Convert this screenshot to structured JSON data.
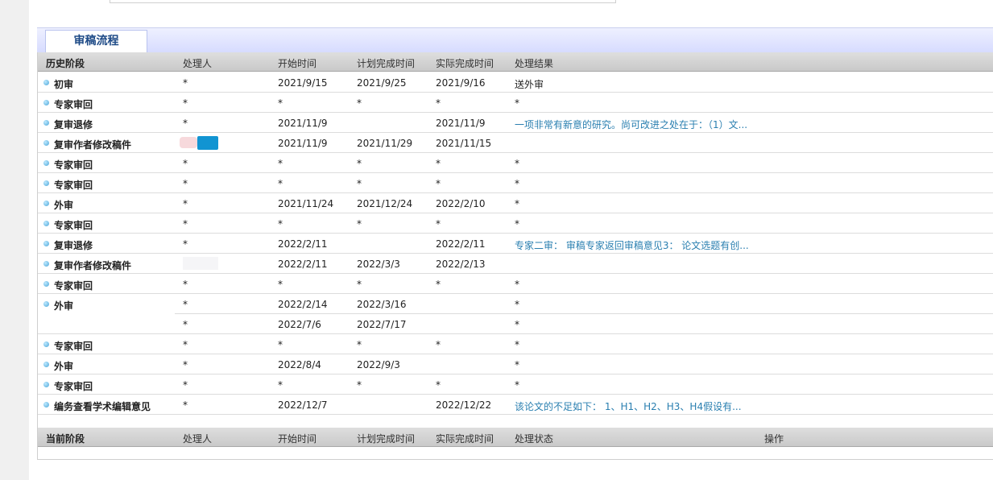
{
  "tab": {
    "label": "审稿流程"
  },
  "history_headers": {
    "stage": "历史阶段",
    "handler": "处理人",
    "start": "开始时间",
    "plan": "计划完成时间",
    "actual": "实际完成时间",
    "result": "处理结果"
  },
  "history_rows": [
    {
      "stage": "初审",
      "handler": "*",
      "start": "2021/9/15",
      "plan": "2021/9/25",
      "actual": "2021/9/16",
      "result": "送外审"
    },
    {
      "stage": "专家审回",
      "handler": "*",
      "start": "*",
      "plan": "*",
      "actual": "*",
      "result": "*"
    },
    {
      "stage": "复审退修",
      "handler": "*",
      "start": "2021/11/9",
      "plan": "",
      "actual": "2021/11/9",
      "result": "一项非常有新意的研究。尚可改进之处在于：（1）文..."
    },
    {
      "stage": "复审作者修改稿件",
      "handler": "",
      "start": "2021/11/9",
      "plan": "2021/11/29",
      "actual": "2021/11/15",
      "result": ""
    },
    {
      "stage": "专家审回",
      "handler": "*",
      "start": "*",
      "plan": "*",
      "actual": "*",
      "result": "*"
    },
    {
      "stage": "专家审回",
      "handler": "*",
      "start": "*",
      "plan": "*",
      "actual": "*",
      "result": "*"
    },
    {
      "stage": "外审",
      "handler": "*",
      "start": "2021/11/24",
      "plan": "2021/12/24",
      "actual": "2022/2/10",
      "result": "*"
    },
    {
      "stage": "专家审回",
      "handler": "*",
      "start": "*",
      "plan": "*",
      "actual": "*",
      "result": "*"
    },
    {
      "stage": "复审退修",
      "handler": "*",
      "start": "2022/2/11",
      "plan": "",
      "actual": "2022/2/11",
      "result": "专家二审： 审稿专家返回审稿意见3： 论文选题有创..."
    },
    {
      "stage": "复审作者修改稿件",
      "handler": "",
      "start": "2022/2/11",
      "plan": "2022/3/3",
      "actual": "2022/2/13",
      "result": ""
    },
    {
      "stage": "专家审回",
      "handler": "*",
      "start": "*",
      "plan": "*",
      "actual": "*",
      "result": "*"
    },
    {
      "stage": "外审",
      "handler": "*",
      "start": "2022/2/14",
      "plan": "2022/3/16",
      "actual": "",
      "result": "*"
    },
    {
      "stage": "",
      "handler": "*",
      "start": "2022/7/6",
      "plan": "2022/7/17",
      "actual": "",
      "result": "*"
    },
    {
      "stage": "专家审回",
      "handler": "*",
      "start": "*",
      "plan": "*",
      "actual": "*",
      "result": "*"
    },
    {
      "stage": "外审",
      "handler": "*",
      "start": "2022/8/4",
      "plan": "2022/9/3",
      "actual": "",
      "result": "*"
    },
    {
      "stage": "专家审回",
      "handler": "*",
      "start": "*",
      "plan": "*",
      "actual": "*",
      "result": "*"
    },
    {
      "stage": "编务查看学术编辑意见",
      "handler": "*",
      "start": "2022/12/7",
      "plan": "",
      "actual": "2022/12/22",
      "result": "该论文的不足如下： 1、H1、H2、H3、H4假设有..."
    }
  ],
  "current_headers": {
    "stage": "当前阶段",
    "handler": "处理人",
    "start": "开始时间",
    "plan": "计划完成时间",
    "actual": "实际完成时间",
    "status": "处理状态",
    "action": "操作"
  },
  "colors": {
    "link": "#2a7fb0",
    "tab_text": "#1f4b87",
    "tab_bar": "#d6dbff"
  }
}
